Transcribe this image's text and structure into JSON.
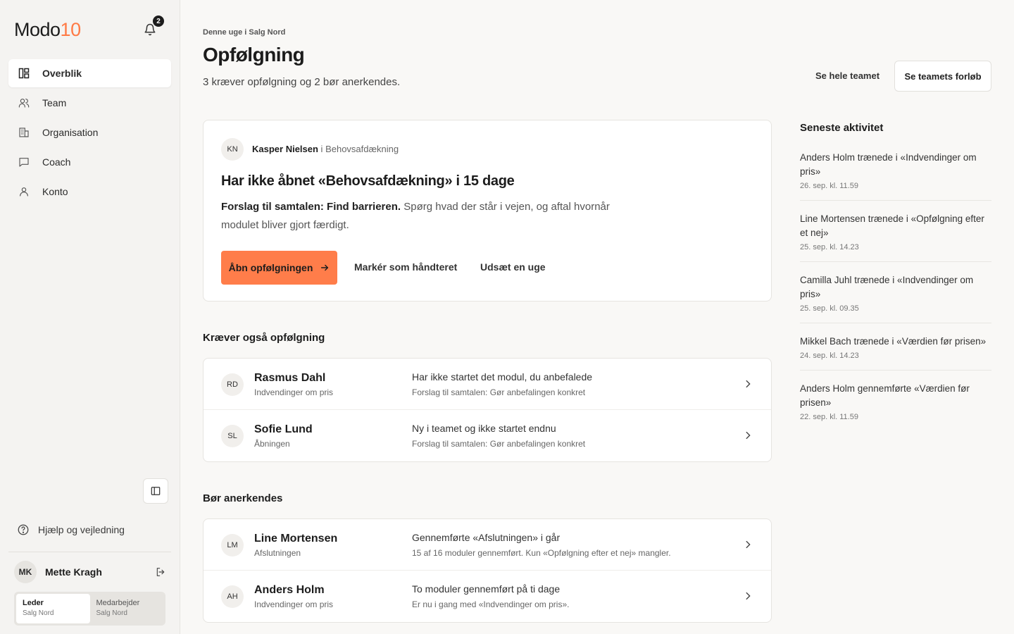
{
  "app": {
    "logo_text": "Modo",
    "logo_num": "10",
    "notification_count": "2"
  },
  "sidebar": {
    "items": [
      {
        "label": "Overblik",
        "icon": "layout-icon",
        "active": true
      },
      {
        "label": "Team",
        "icon": "users-icon"
      },
      {
        "label": "Organisation",
        "icon": "building-icon"
      },
      {
        "label": "Coach",
        "icon": "chat-icon"
      },
      {
        "label": "Konto",
        "icon": "user-icon"
      }
    ],
    "help_label": "Hjælp og vejledning",
    "user": {
      "initials": "MK",
      "name": "Mette Kragh"
    },
    "roles": [
      {
        "title": "Leder",
        "sub": "Salg Nord",
        "active": true
      },
      {
        "title": "Medarbejder",
        "sub": "Salg Nord"
      }
    ]
  },
  "header": {
    "eyebrow": "Denne uge i Salg Nord",
    "title": "Opfølgning",
    "subtitle": "3 kræver opfølgning og 2 bør anerkendes.",
    "link_label": "Se hele teamet",
    "button_label": "Se teamets forløb"
  },
  "focus": {
    "initials": "KN",
    "name": "Kasper Nielsen",
    "connector": " i ",
    "module": "Behovsafdækning",
    "headline": "Har ikke åbnet «Behovsafdækning» i 15 dage",
    "suggestion_bold": "Forslag til samtalen: Find barrieren.",
    "suggestion_rest": " Spørg hvad der står i vejen, og aftal hvornår modulet bliver gjort færdigt.",
    "primary_label": "Åbn opfølgningen",
    "mark_label": "Markér som håndteret",
    "postpone_label": "Udsæt en uge"
  },
  "followup": {
    "title": "Kræver også opfølgning",
    "rows": [
      {
        "initials": "RD",
        "name": "Rasmus Dahl",
        "module": "Indvendinger om pris",
        "reason": "Har ikke startet det modul, du anbefalede",
        "hint": "Forslag til samtalen: Gør anbefalingen konkret"
      },
      {
        "initials": "SL",
        "name": "Sofie Lund",
        "module": "Åbningen",
        "reason": "Ny i teamet og ikke startet endnu",
        "hint": "Forslag til samtalen: Gør anbefalingen konkret"
      }
    ]
  },
  "recognize": {
    "title": "Bør anerkendes",
    "rows": [
      {
        "initials": "LM",
        "name": "Line Mortensen",
        "module": "Afslutningen",
        "reason": "Gennemførte «Afslutningen» i går",
        "hint": "15 af 16 moduler gennemført. Kun «Opfølgning efter et nej» mangler."
      },
      {
        "initials": "AH",
        "name": "Anders Holm",
        "module": "Indvendinger om pris",
        "reason": "To moduler gennemført på ti dage",
        "hint": "Er nu i gang med «Indvendinger om pris»."
      }
    ]
  },
  "activity": {
    "title": "Seneste aktivitet",
    "items": [
      {
        "text": "Anders Holm trænede i «Indvendinger om pris»",
        "time": "26. sep. kl. 11.59"
      },
      {
        "text": "Line Mortensen trænede i «Opfølgning efter et nej»",
        "time": "25. sep. kl. 14.23"
      },
      {
        "text": "Camilla Juhl trænede i «Indvendinger om pris»",
        "time": "25. sep. kl. 09.35"
      },
      {
        "text": "Mikkel Bach trænede i «Værdien før prisen»",
        "time": "24. sep. kl. 14.23"
      },
      {
        "text": "Anders Holm gennemførte «Værdien før prisen»",
        "time": "22. sep. kl. 11.59"
      }
    ]
  },
  "colors": {
    "accent": "#ff7d4a",
    "background": "#f9f8f6",
    "sidebar": "#f4f3f1"
  }
}
